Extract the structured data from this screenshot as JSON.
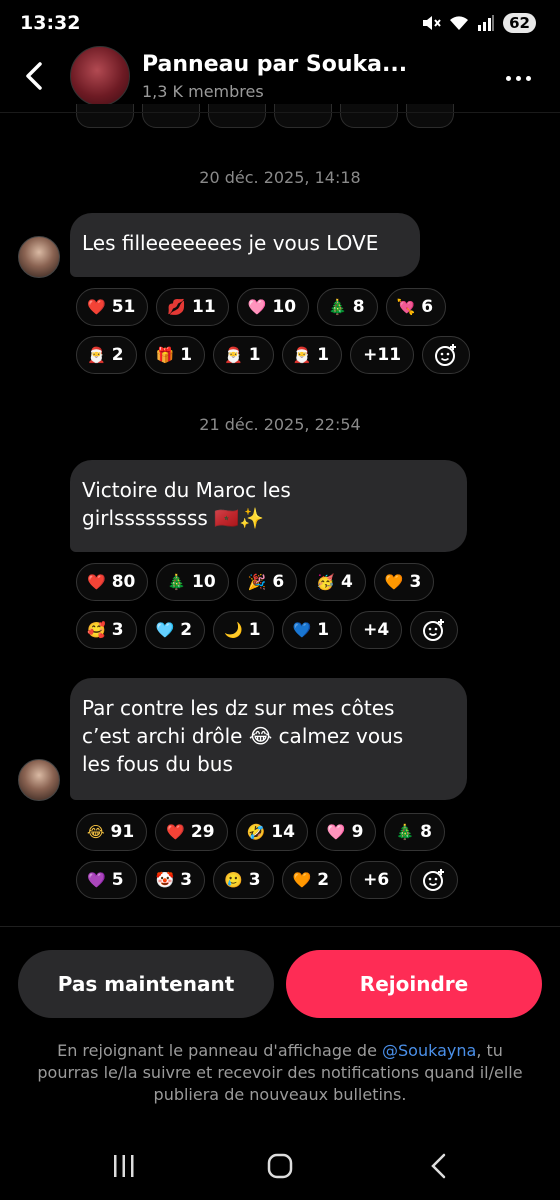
{
  "status_bar": {
    "time": "13:32",
    "battery": "62"
  },
  "header": {
    "title": "Panneau par Souka...",
    "subtitle": "1,3 K membres"
  },
  "messages": [
    {
      "timestamp": "20 déc. 2025, 14:18",
      "text": "Les filleeeeeees je vous LOVE",
      "reactions": [
        [
          {
            "emoji": "❤️",
            "count": "51",
            "color": "#ff3b5c"
          },
          {
            "emoji": "💋",
            "count": "11",
            "color": "#e0263c"
          },
          {
            "emoji": "🩷",
            "count": "10",
            "color": "#ff8cc6"
          },
          {
            "emoji": "🎄",
            "count": "8",
            "color": "#3a9c3a"
          },
          {
            "emoji": "💘",
            "count": "6",
            "color": "#ff4f8a"
          }
        ],
        [
          {
            "emoji": "🎅",
            "count": "2",
            "color": "#d83b3b"
          },
          {
            "emoji": "🎁",
            "count": "1",
            "color": "#e03b3b"
          },
          {
            "emoji": "🎅",
            "count": "1",
            "color": "#d83b3b"
          },
          {
            "emoji": "🎅",
            "count": "1",
            "color": "#d83b3b"
          },
          {
            "more": "+11"
          }
        ]
      ]
    },
    {
      "timestamp": "21 déc. 2025, 22:54",
      "text_lines": [
        "Victoire du Maroc les",
        "girlsssssssss 🇲🇦✨"
      ],
      "reactions": [
        [
          {
            "emoji": "❤️",
            "count": "80",
            "color": "#ff3b5c"
          },
          {
            "emoji": "🎄",
            "count": "10",
            "color": "#3a9c3a"
          },
          {
            "emoji": "🎉",
            "count": "6",
            "color": "#f0a020"
          },
          {
            "emoji": "🥳",
            "count": "4",
            "color": "#f5c242"
          },
          {
            "emoji": "🧡",
            "count": "3",
            "color": "#b2643a"
          }
        ],
        [
          {
            "emoji": "🥰",
            "count": "3",
            "color": "#f5c242"
          },
          {
            "emoji": "🩵",
            "count": "2",
            "color": "#6fd2f0"
          },
          {
            "emoji": "🌙",
            "count": "1",
            "color": "#f3c04a"
          },
          {
            "emoji": "💙",
            "count": "1",
            "color": "#2a7de1"
          },
          {
            "more": "+4"
          }
        ]
      ]
    },
    {
      "text_lines": [
        "Par contre les dz sur mes côtes",
        "c’est archi drôle 😂 calmez vous",
        "les fous du bus"
      ],
      "reactions": [
        [
          {
            "emoji": "😂",
            "count": "91",
            "color": "#f5c242"
          },
          {
            "emoji": "❤️",
            "count": "29",
            "color": "#ff3b5c"
          },
          {
            "emoji": "🤣",
            "count": "14",
            "color": "#f5c242"
          },
          {
            "emoji": "🩷",
            "count": "9",
            "color": "#ff8cc6"
          },
          {
            "emoji": "🎄",
            "count": "8",
            "color": "#3a9c3a"
          }
        ],
        [
          {
            "emoji": "💜",
            "count": "5",
            "color": "#9b4de0"
          },
          {
            "emoji": "🤡",
            "count": "3",
            "color": "#e8e8e8"
          },
          {
            "emoji": "🥲",
            "count": "3",
            "color": "#f5c242"
          },
          {
            "emoji": "🧡",
            "count": "2",
            "color": "#b2643a"
          },
          {
            "more": "+6"
          }
        ]
      ]
    }
  ],
  "actions": {
    "not_now": "Pas maintenant",
    "join": "Rejoindre"
  },
  "notice": {
    "before": "En rejoignant le panneau d'affichage de ",
    "mention": "@Soukayna",
    "after": ", tu pourras le/la suivre et recevoir des notifications quand il/elle publiera de nouveaux bulletins."
  },
  "colors": {
    "primary": "#fe2c55",
    "bubble": "#2a2a2c",
    "mention": "#4a8fe8"
  }
}
